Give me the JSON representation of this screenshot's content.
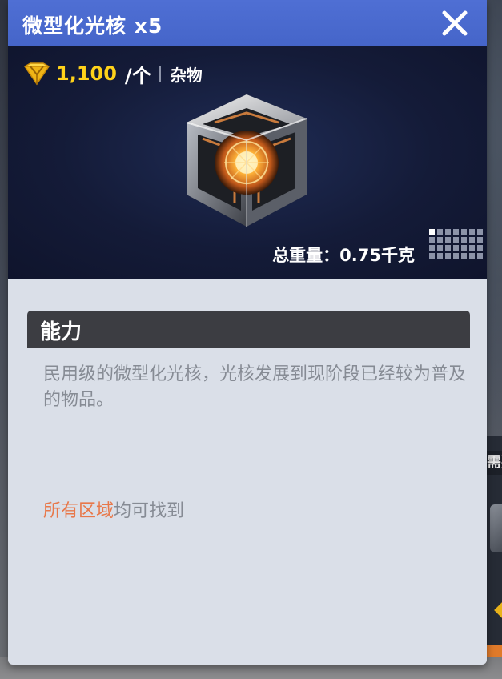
{
  "item": {
    "title": "微型化光核 x5",
    "price": "1,100",
    "price_unit": "/个",
    "category": "杂物",
    "weight_text": "总重量：0.75千克"
  },
  "ability": {
    "header": "能力",
    "description": "民用级的微型化光核，光核发展到现阶段已经较为普及的物品。"
  },
  "source": {
    "highlight": "所有区域",
    "rest": "均可找到"
  },
  "background": {
    "right_card_header": "需要"
  },
  "icons": {
    "currency": "gem-icon",
    "close": "close-icon",
    "grid": "grid-size-icon",
    "item": "light-core-cube"
  },
  "colors": {
    "title_bar": "#4565c9",
    "price": "#ffd21a",
    "source_highlight": "#e8784a",
    "panel": "#dadfe8"
  }
}
